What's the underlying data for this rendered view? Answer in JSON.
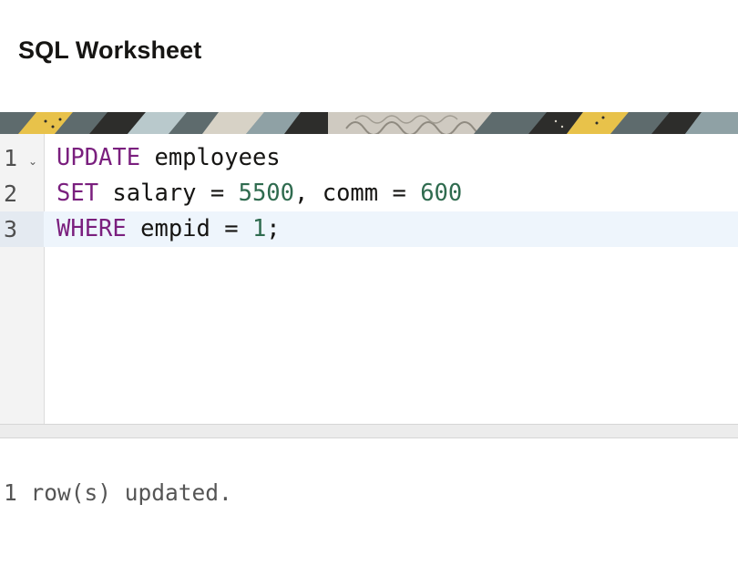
{
  "header": {
    "title": "SQL Worksheet"
  },
  "banner": {
    "icon": "decorative-pattern",
    "colors": [
      "#5e6b6d",
      "#e8c24a",
      "#b9c9cc",
      "#2d2d2b",
      "#d7d2c6",
      "#8fa1a5"
    ]
  },
  "editor": {
    "active_line": 3,
    "fold_icon": "chevron-down-icon",
    "lines": [
      {
        "number": "1",
        "tokens": [
          {
            "type": "keyword",
            "text": "UPDATE"
          },
          {
            "type": "plain",
            "text": " employees"
          }
        ]
      },
      {
        "number": "2",
        "tokens": [
          {
            "type": "keyword",
            "text": "SET"
          },
          {
            "type": "plain",
            "text": " salary = "
          },
          {
            "type": "number",
            "text": "5500"
          },
          {
            "type": "plain",
            "text": ", comm = "
          },
          {
            "type": "number",
            "text": "600"
          }
        ]
      },
      {
        "number": "3",
        "tokens": [
          {
            "type": "keyword",
            "text": "WHERE"
          },
          {
            "type": "plain",
            "text": " empid = "
          },
          {
            "type": "number",
            "text": "1"
          },
          {
            "type": "plain",
            "text": ";"
          }
        ]
      }
    ]
  },
  "output": {
    "message": "1 row(s) updated."
  }
}
